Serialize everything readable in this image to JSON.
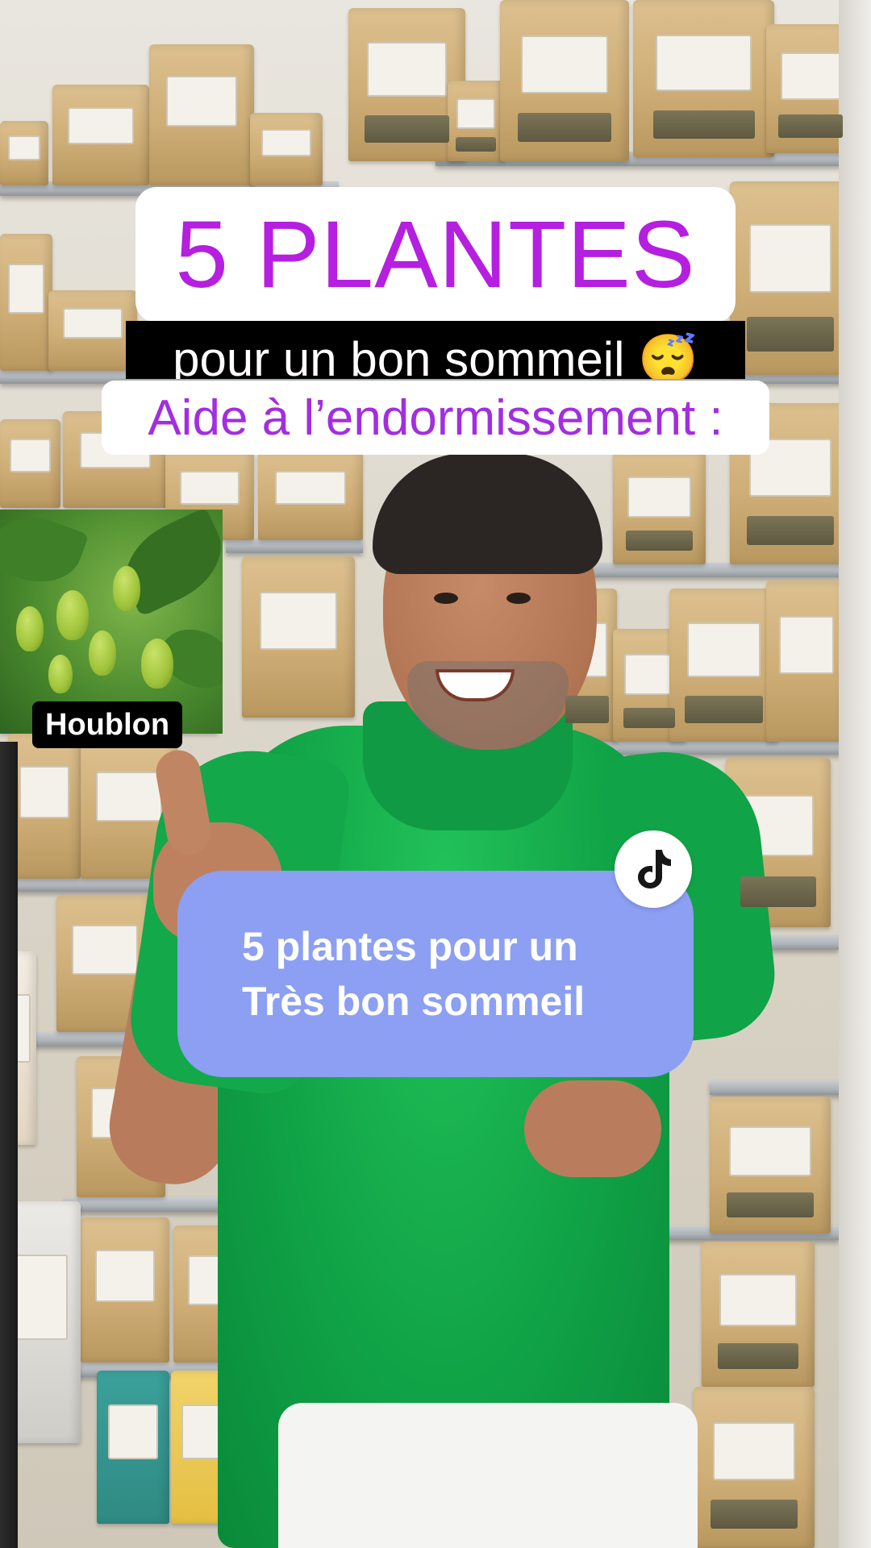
{
  "overlay": {
    "title": "5 PLANTES",
    "subtitle": "pour un bon sommeil 😴",
    "heading": "Aide à l’endormissement :"
  },
  "plant": {
    "label": "Houblon"
  },
  "card": {
    "line1": "5 plantes pour un",
    "line2": "Très bon sommeil",
    "badge_icon": "tiktok-icon"
  },
  "colors": {
    "title_purple": "#b51fe0",
    "heading_purple": "#a22ee0",
    "card_blue": "#8c9ff2",
    "shirt_green": "#10a246"
  }
}
